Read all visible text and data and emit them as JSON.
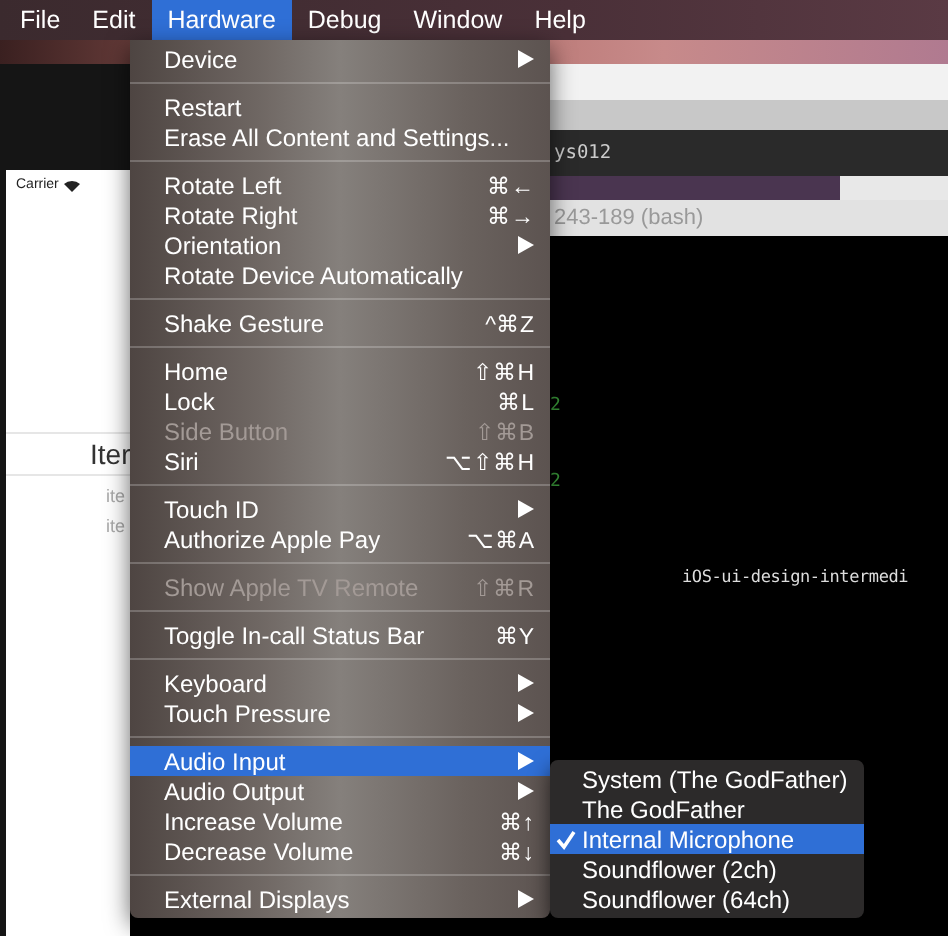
{
  "menubar": [
    {
      "label": "File",
      "selected": false
    },
    {
      "label": "Edit",
      "selected": false
    },
    {
      "label": "Hardware",
      "selected": true
    },
    {
      "label": "Debug",
      "selected": false
    },
    {
      "label": "Window",
      "selected": false
    },
    {
      "label": "Help",
      "selected": false
    }
  ],
  "simulator": {
    "carrier": "Carrier",
    "heading": "Iter",
    "rows": [
      "ite",
      "ite"
    ]
  },
  "terminal": {
    "title_fragment": "ys012",
    "tab": "243-189 (bash)",
    "marks": [
      "2",
      "2"
    ],
    "path": "iOS-ui-design-intermedi"
  },
  "menu": [
    {
      "kind": "item",
      "label": "Device",
      "submenu": true,
      "disabled": false,
      "selected": false
    },
    {
      "kind": "separator"
    },
    {
      "kind": "item",
      "label": "Restart",
      "submenu": false,
      "disabled": false,
      "selected": false
    },
    {
      "kind": "item",
      "label": "Erase All Content and Settings...",
      "submenu": false,
      "disabled": false,
      "selected": false
    },
    {
      "kind": "separator"
    },
    {
      "kind": "item",
      "label": "Rotate Left",
      "shortcut": "⌘←",
      "submenu": false,
      "disabled": false,
      "selected": false
    },
    {
      "kind": "item",
      "label": "Rotate Right",
      "shortcut": "⌘→",
      "submenu": false,
      "disabled": false,
      "selected": false
    },
    {
      "kind": "item",
      "label": "Orientation",
      "submenu": true,
      "disabled": false,
      "selected": false
    },
    {
      "kind": "item",
      "label": "Rotate Device Automatically",
      "submenu": false,
      "disabled": false,
      "selected": false
    },
    {
      "kind": "separator"
    },
    {
      "kind": "item",
      "label": "Shake Gesture",
      "shortcut": "^⌘Z",
      "submenu": false,
      "disabled": false,
      "selected": false
    },
    {
      "kind": "separator"
    },
    {
      "kind": "item",
      "label": "Home",
      "shortcut": "⇧⌘H",
      "submenu": false,
      "disabled": false,
      "selected": false
    },
    {
      "kind": "item",
      "label": "Lock",
      "shortcut": "⌘L",
      "submenu": false,
      "disabled": false,
      "selected": false
    },
    {
      "kind": "item",
      "label": "Side Button",
      "shortcut": "⇧⌘B",
      "submenu": false,
      "disabled": true,
      "selected": false
    },
    {
      "kind": "item",
      "label": "Siri",
      "shortcut": "⌥⇧⌘H",
      "submenu": false,
      "disabled": false,
      "selected": false
    },
    {
      "kind": "separator"
    },
    {
      "kind": "item",
      "label": "Touch ID",
      "submenu": true,
      "disabled": false,
      "selected": false
    },
    {
      "kind": "item",
      "label": "Authorize Apple Pay",
      "shortcut": "⌥⌘A",
      "submenu": false,
      "disabled": false,
      "selected": false
    },
    {
      "kind": "separator"
    },
    {
      "kind": "item",
      "label": "Show Apple TV Remote",
      "shortcut": "⇧⌘R",
      "submenu": false,
      "disabled": true,
      "selected": false
    },
    {
      "kind": "separator"
    },
    {
      "kind": "item",
      "label": "Toggle In-call Status Bar",
      "shortcut": "⌘Y",
      "submenu": false,
      "disabled": false,
      "selected": false
    },
    {
      "kind": "separator"
    },
    {
      "kind": "item",
      "label": "Keyboard",
      "submenu": true,
      "disabled": false,
      "selected": false
    },
    {
      "kind": "item",
      "label": "Touch Pressure",
      "submenu": true,
      "disabled": false,
      "selected": false
    },
    {
      "kind": "separator"
    },
    {
      "kind": "item",
      "label": "Audio Input",
      "submenu": true,
      "disabled": false,
      "selected": true
    },
    {
      "kind": "item",
      "label": "Audio Output",
      "submenu": true,
      "disabled": false,
      "selected": false
    },
    {
      "kind": "item",
      "label": "Increase Volume",
      "shortcut": "⌘↑",
      "submenu": false,
      "disabled": false,
      "selected": false
    },
    {
      "kind": "item",
      "label": "Decrease Volume",
      "shortcut": "⌘↓",
      "submenu": false,
      "disabled": false,
      "selected": false
    },
    {
      "kind": "separator"
    },
    {
      "kind": "item",
      "label": "External Displays",
      "submenu": true,
      "disabled": false,
      "selected": false
    }
  ],
  "submenu": [
    {
      "label": "System (The GodFather)",
      "checked": false,
      "selected": false
    },
    {
      "label": "The GodFather",
      "checked": false,
      "selected": false
    },
    {
      "label": "Internal Microphone",
      "checked": true,
      "selected": true
    },
    {
      "label": "Soundflower (2ch)",
      "checked": false,
      "selected": false
    },
    {
      "label": "Soundflower (64ch)",
      "checked": false,
      "selected": false
    }
  ]
}
